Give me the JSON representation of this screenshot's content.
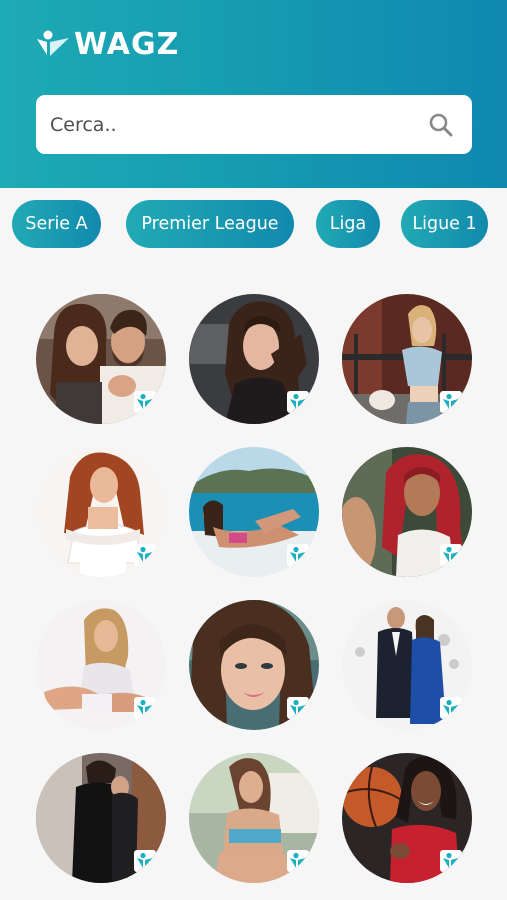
{
  "app": {
    "name": "WAGZ"
  },
  "search": {
    "placeholder": "Cerca.."
  },
  "leagues": [
    "Serie A",
    "Premier League",
    "Liga",
    "Ligue 1"
  ],
  "colors": {
    "header_start": "#1eaab4",
    "header_end": "#1088b0",
    "chip": "#1a9db3",
    "badge": "#1ab0c0"
  }
}
